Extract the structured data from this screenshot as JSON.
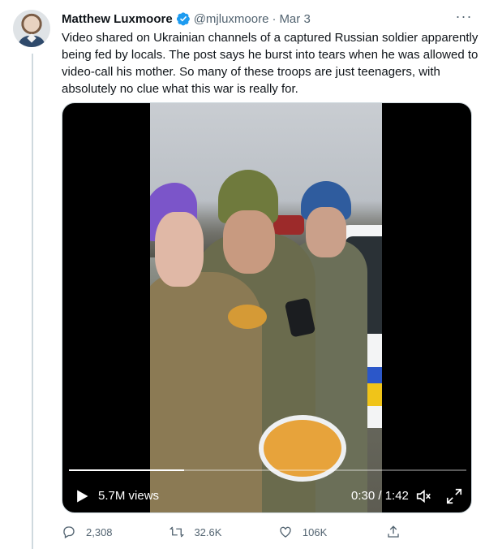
{
  "tweet": {
    "author": "Matthew Luxmoore",
    "handle": "@mjluxmoore",
    "separator": "·",
    "date": "Mar 3",
    "text": "Video shared on Ukrainian channels of a captured Russian soldier apparently being fed by locals. The post says he burst into tears when he was allowed to video-call his mother. So many of these troops are just teenagers, with absolutely no clue what this war is really for.",
    "verified": true
  },
  "video": {
    "views": "5.7M views",
    "time": "0:30 / 1:42",
    "progress": 0.29,
    "icons": [
      "play-icon",
      "volume-icon",
      "fullscreen-icon"
    ]
  },
  "actions": {
    "replies": "2,308",
    "retweets": "32.6K",
    "likes": "106K",
    "icons": [
      "reply-icon",
      "retweet-icon",
      "like-icon",
      "share-icon"
    ]
  },
  "colors": {
    "verified": "#1d9bf0",
    "muted": "#536471",
    "text": "#0f1419"
  }
}
